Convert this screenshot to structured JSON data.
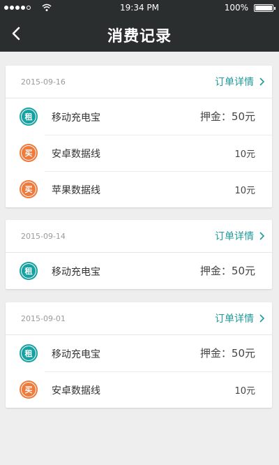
{
  "status": {
    "time": "19:34 PM",
    "battery": "100%"
  },
  "header": {
    "title": "消费记录"
  },
  "orders": [
    {
      "date": "2015-09-16",
      "detail": "订单详情",
      "items": [
        {
          "badge": "租",
          "type": "rent",
          "name": "移动充电宝",
          "price": "押金：50元"
        },
        {
          "badge": "买",
          "type": "buy",
          "name": "安卓数据线",
          "price": "10元"
        },
        {
          "badge": "买",
          "type": "buy",
          "name": "苹果数据线",
          "price": "10元"
        }
      ]
    },
    {
      "date": "2015-09-14",
      "detail": "订单详情",
      "items": [
        {
          "badge": "租",
          "type": "rent",
          "name": "移动充电宝",
          "price": "押金：50元"
        }
      ]
    },
    {
      "date": "2015-09-01",
      "detail": "订单详情",
      "items": [
        {
          "badge": "租",
          "type": "rent",
          "name": "移动充电宝",
          "price": "押金：50元"
        },
        {
          "badge": "买",
          "type": "buy",
          "name": "安卓数据线",
          "price": "10元"
        }
      ]
    }
  ]
}
